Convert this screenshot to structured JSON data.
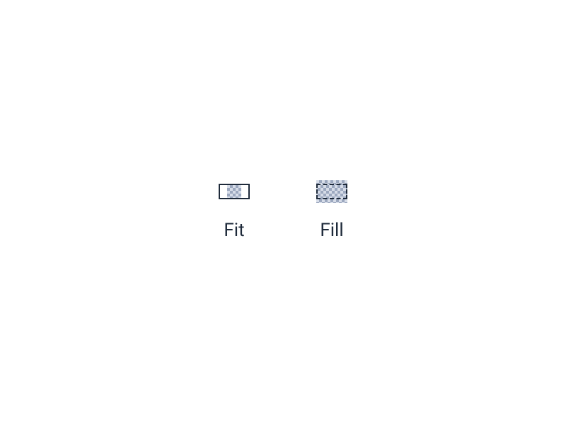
{
  "sizing_options": {
    "fit": {
      "label": "Fit",
      "icon_name": "fit-icon"
    },
    "fill": {
      "label": "Fill",
      "icon_name": "fill-icon"
    }
  },
  "colors": {
    "text": "#1e2a3a",
    "frame": "#1e2a3a",
    "checker_light": "#d6dce8",
    "checker_dark": "#9ca8bf"
  }
}
